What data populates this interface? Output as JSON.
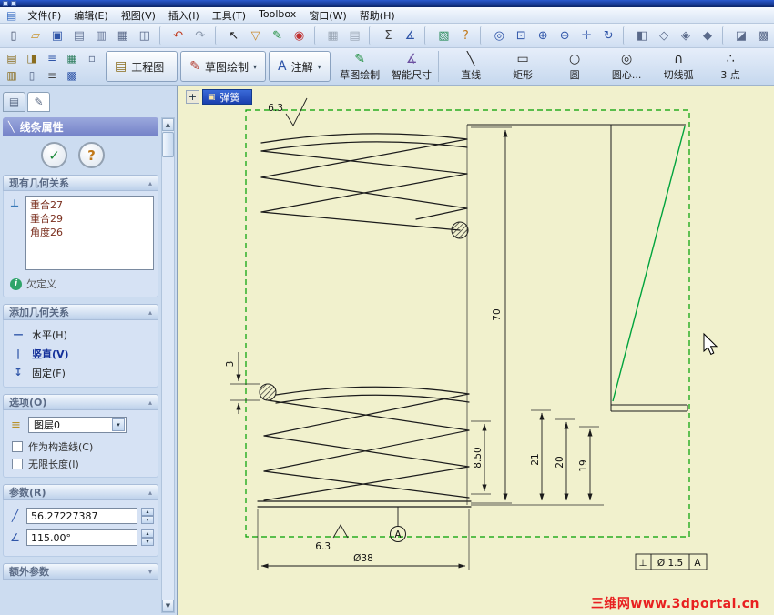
{
  "menu": {
    "icon_glyph": "▤",
    "items": [
      "文件(F)",
      "编辑(E)",
      "视图(V)",
      "插入(I)",
      "工具(T)",
      "Toolbox",
      "窗口(W)",
      "帮助(H)"
    ]
  },
  "toolbar_main": {
    "icons": [
      {
        "name": "new-document",
        "glyph": "▯",
        "color": "#44506a"
      },
      {
        "name": "open-folder",
        "glyph": "▱",
        "color": "#c9952f"
      },
      {
        "name": "save",
        "glyph": "▣",
        "color": "#2f55a8"
      },
      {
        "name": "make-drawing-from-part",
        "glyph": "▤",
        "color": "#6a7a9a"
      },
      {
        "name": "make-assembly-from-part",
        "glyph": "▥",
        "color": "#6a7a9a"
      },
      {
        "name": "print",
        "glyph": "▦",
        "color": "#5a6a8a"
      },
      {
        "name": "print-preview",
        "glyph": "◫",
        "color": "#5a6a8a"
      },
      {
        "name": "separator",
        "glyph": ""
      },
      {
        "name": "undo",
        "glyph": "↶",
        "color": "#c03a1e"
      },
      {
        "name": "redo",
        "glyph": "↷",
        "color": "#8a98ac"
      },
      {
        "name": "separator",
        "glyph": ""
      },
      {
        "name": "select",
        "glyph": "↖",
        "color": "#1c1c1c"
      },
      {
        "name": "selection-filter",
        "glyph": "▽",
        "color": "#c98a2f"
      },
      {
        "name": "sketch",
        "glyph": "✎",
        "color": "#1e8e3e"
      },
      {
        "name": "rebuild",
        "glyph": "◉",
        "color": "#c03030"
      },
      {
        "name": "separator",
        "glyph": ""
      },
      {
        "name": "design-table",
        "glyph": "▦",
        "color": "#9aa6b4"
      },
      {
        "name": "hole-table",
        "glyph": "▤",
        "color": "#9aa6b4"
      },
      {
        "name": "separator",
        "glyph": ""
      },
      {
        "name": "equations",
        "glyph": "Σ",
        "color": "#444444"
      },
      {
        "name": "measure",
        "glyph": "∡",
        "color": "#2f55a8"
      },
      {
        "name": "separator",
        "glyph": ""
      },
      {
        "name": "new-sheet",
        "glyph": "▧",
        "color": "#2e8e5e"
      },
      {
        "name": "help",
        "glyph": "?",
        "color": "#c07818"
      },
      {
        "name": "separator",
        "glyph": ""
      },
      {
        "name": "zoom-fit",
        "glyph": "◎",
        "color": "#2f55a8"
      },
      {
        "name": "zoom-to-area",
        "glyph": "⊡",
        "color": "#2f55a8"
      },
      {
        "name": "zoom-in",
        "glyph": "⊕",
        "color": "#2f55a8"
      },
      {
        "name": "zoom-out",
        "glyph": "⊖",
        "color": "#2f55a8"
      },
      {
        "name": "pan",
        "glyph": "✛",
        "color": "#2f55a8"
      },
      {
        "name": "rotate-view",
        "glyph": "↻",
        "color": "#2f55a8"
      },
      {
        "name": "separator",
        "glyph": ""
      },
      {
        "name": "view-orientation",
        "glyph": "◧",
        "color": "#5a6a8a"
      },
      {
        "name": "wireframe",
        "glyph": "◇",
        "color": "#5a6a8a"
      },
      {
        "name": "hidden-lines-visible",
        "glyph": "◈",
        "color": "#5a6a8a"
      },
      {
        "name": "shaded",
        "glyph": "◆",
        "color": "#5a6a8a"
      },
      {
        "name": "separator",
        "glyph": ""
      },
      {
        "name": "section-view",
        "glyph": "◪",
        "color": "#5a6a8a"
      },
      {
        "name": "full-screen",
        "glyph": "▩",
        "color": "#5a6a8a"
      }
    ]
  },
  "mini_top": {
    "icons": [
      {
        "name": "sheet-properties",
        "glyph": "▤",
        "color": "#8a6d1f"
      },
      {
        "name": "edit-sheet-format",
        "glyph": "◨",
        "color": "#8a6d1f"
      },
      {
        "name": "line-font",
        "glyph": "≡",
        "color": "#2f55a8"
      },
      {
        "name": "layer-properties",
        "glyph": "▦",
        "color": "#2e7e5e"
      },
      {
        "name": "grid-snap",
        "glyph": "▫",
        "color": "#5a6a8a"
      }
    ]
  },
  "mini_bottom": {
    "icons": [
      {
        "name": "drawing-views",
        "glyph": "▥",
        "color": "#8a6d1f"
      },
      {
        "name": "note",
        "glyph": "▯",
        "color": "#5a6a8a"
      },
      {
        "name": "line-weight",
        "glyph": "≡",
        "color": "#444444"
      },
      {
        "name": "layer-grid",
        "glyph": "▩",
        "color": "#2f55a8"
      }
    ]
  },
  "command_manager": {
    "tabs": [
      {
        "name": "tab-drawing",
        "label": "工程图",
        "glyph": "▤",
        "color": "#8a6d1f",
        "arrow": ""
      },
      {
        "name": "tab-sketch",
        "label": "草图绘制",
        "glyph": "✎",
        "color": "#b03a2e",
        "arrow": "▾"
      },
      {
        "name": "tab-annotation",
        "label": "注解",
        "glyph": "A",
        "color": "#2f55a8",
        "arrow": "▾"
      }
    ],
    "tools": [
      {
        "name": "tool-sketch",
        "label": "草图绘制",
        "glyph": "✎",
        "color": "#1e8e3e"
      },
      {
        "name": "tool-smart-dimension",
        "label": "智能尺寸",
        "glyph": "∡",
        "color": "#6b4fa0"
      },
      {
        "name": "separator"
      },
      {
        "name": "tool-line",
        "label": "直线",
        "glyph": "╲",
        "color": "#2a2a2a"
      },
      {
        "name": "tool-rectangle",
        "label": "矩形",
        "glyph": "▭",
        "color": "#2a2a2a"
      },
      {
        "name": "tool-circle",
        "label": "圆",
        "glyph": "○",
        "color": "#2a2a2a"
      },
      {
        "name": "tool-centerpoint-circle",
        "label": "圆心...",
        "glyph": "◎",
        "color": "#2a2a2a"
      },
      {
        "name": "tool-tangent-arc",
        "label": "切线弧",
        "glyph": "∩",
        "color": "#2a2a2a"
      },
      {
        "name": "tool-3point-arc",
        "label": "3 点",
        "glyph": "∴",
        "color": "#2a2a2a"
      }
    ]
  },
  "panel": {
    "tabs_icons": [
      "▤",
      "✎"
    ],
    "title": "线条属性",
    "title_icon": "╲",
    "ok_glyph": "✓",
    "help_glyph": "?",
    "spin_up": "▴",
    "spin_down": "▾",
    "scroll_up": "▲",
    "scroll_down": "▼",
    "sections": {
      "existing": {
        "title": "现有几何关系",
        "tri": "▴",
        "icon": "⊥",
        "relations": [
          "重合27",
          "重合29",
          "角度26"
        ],
        "status_icon": "i",
        "status": "欠定义"
      },
      "add": {
        "title": "添加几何关系",
        "tri": "▴",
        "horizontal": {
          "glyph": "—",
          "label": "水平(H)"
        },
        "vertical": {
          "glyph": "|",
          "label": "竖直(V)"
        },
        "fix": {
          "glyph": "↧",
          "label": "固定(F)"
        }
      },
      "options": {
        "title": "选项(O)",
        "tri": "▴",
        "layer_icon": "≡",
        "layer_value": "图层0",
        "dd_arrow": "▾",
        "construction": "作为构造线(C)",
        "infinite": "无限长度(I)"
      },
      "parameters": {
        "title": "参数(R)",
        "tri": "▴",
        "length_icon": "╱",
        "length": "56.27227387",
        "angle_icon": "∠",
        "angle": "115.00°"
      },
      "extra": {
        "title": "额外参数",
        "tri": "▾"
      }
    }
  },
  "drawing": {
    "tab_plus": "+",
    "tab_icon": "▣",
    "tab": "弹簧",
    "dims": {
      "rough_top": "6.3",
      "height": "70",
      "wire": "3",
      "pitch": "8.50",
      "h21": "21",
      "h20": "20",
      "h19": "19",
      "dia": "Ø38",
      "rough_bottom": "6.3",
      "datum": "A",
      "gdt_sym": "⊥",
      "gdt_tol": "Ø 1.5",
      "gdt_datum": "A"
    },
    "watermark": "三维网www.3dportal.cn",
    "colors": {
      "sheet_bg": "#f1f1cd",
      "sheet_border": "#00a000",
      "selected": "#00a33c",
      "watermark": "#e82020"
    }
  }
}
